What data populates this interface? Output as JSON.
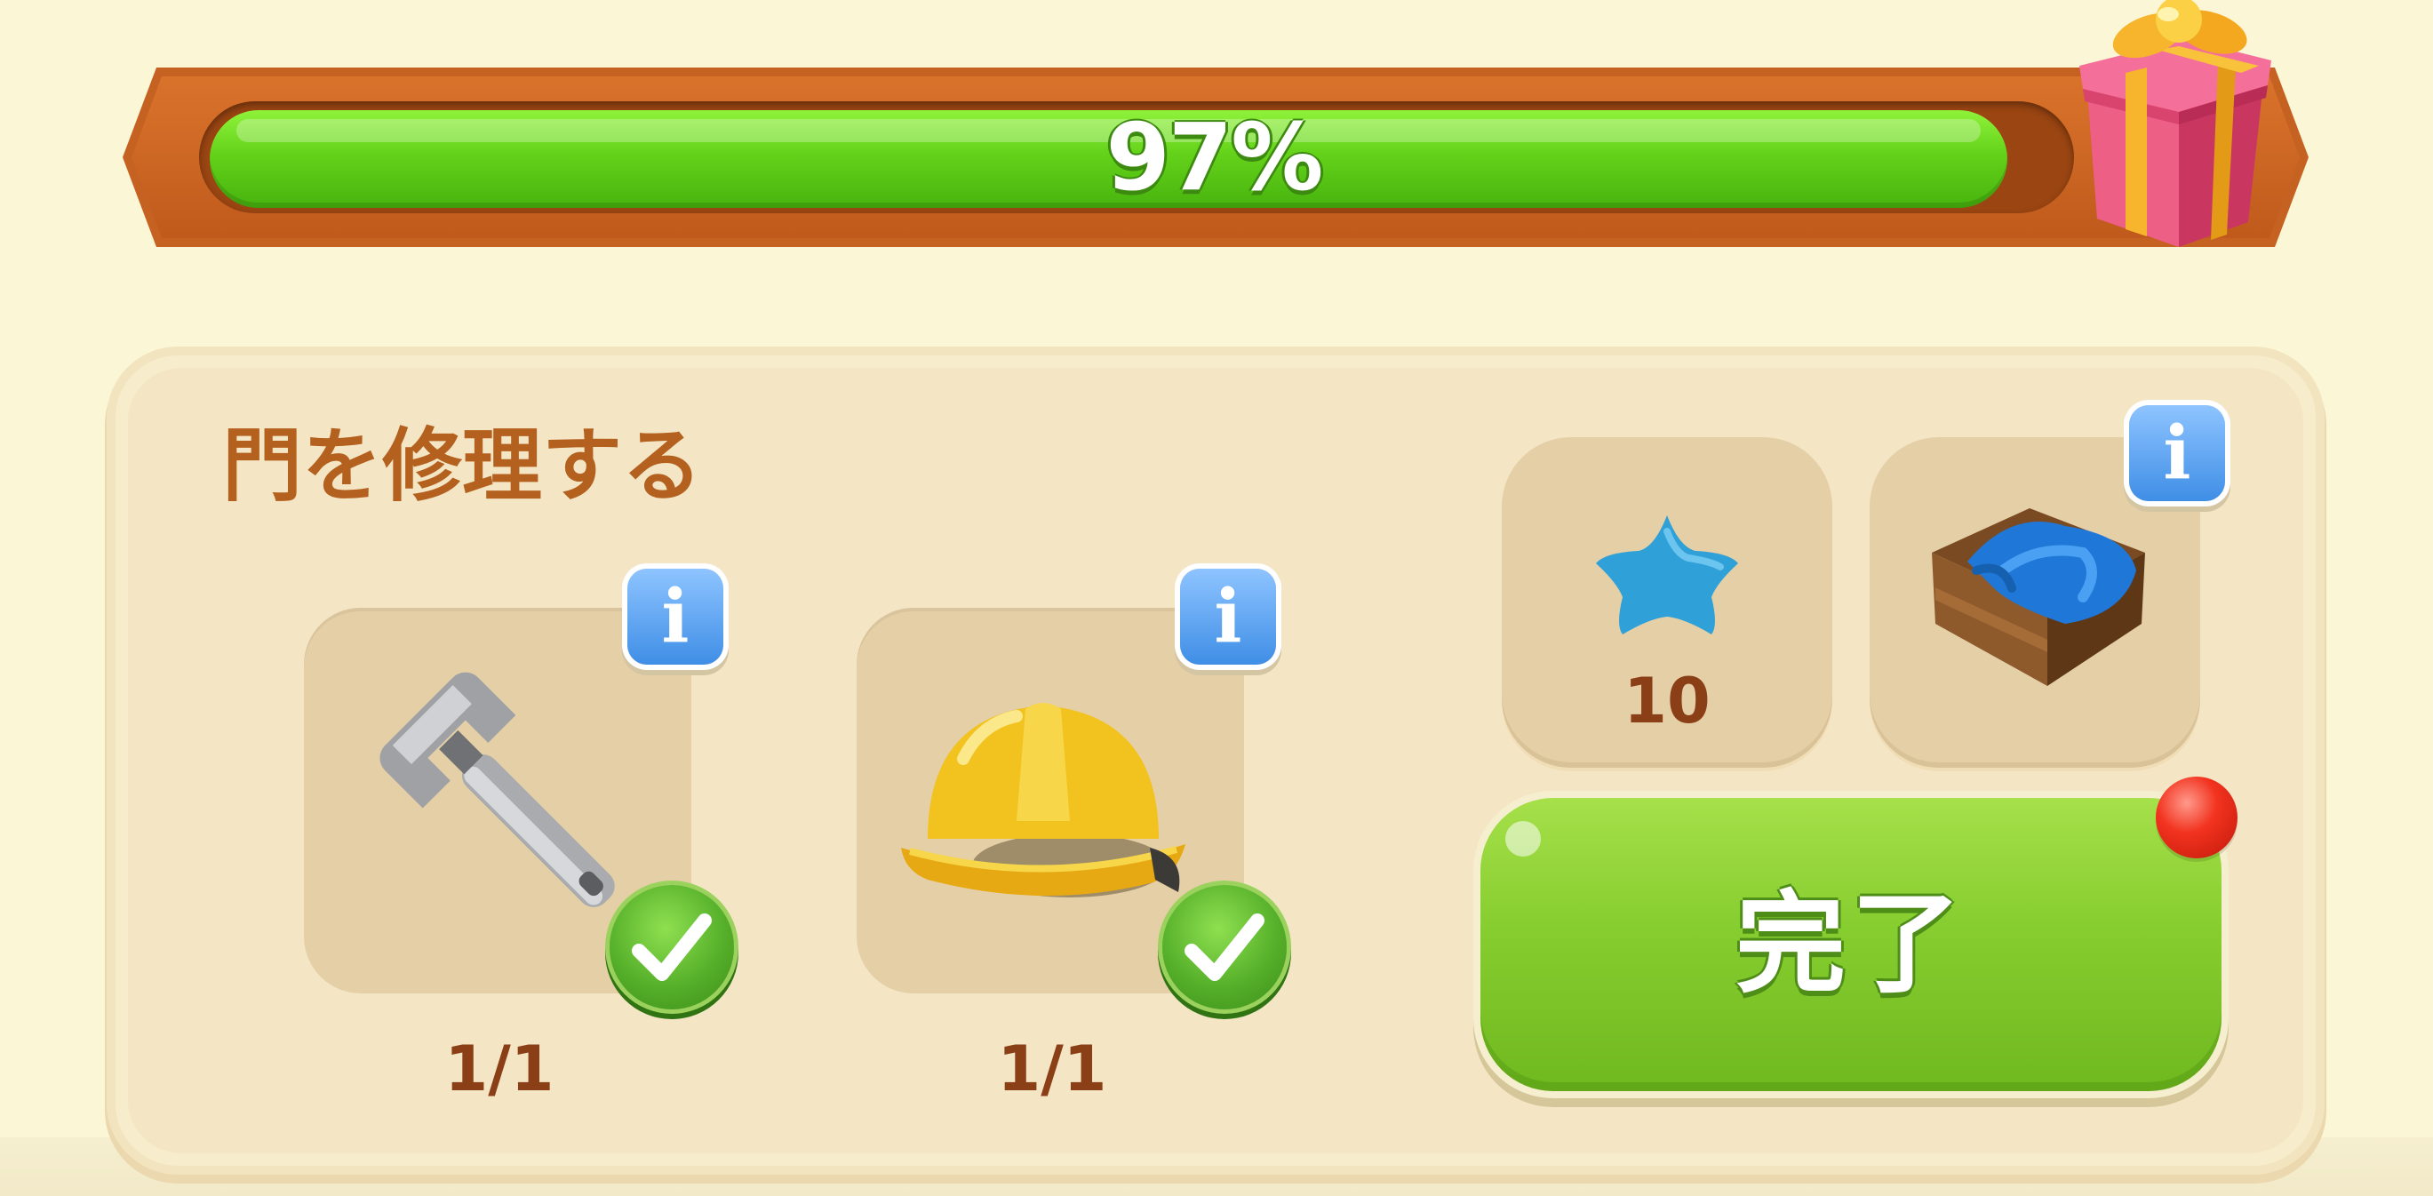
{
  "progress": {
    "percent_label": "97%",
    "fraction": 0.97,
    "reward_icon": "gift-box-icon"
  },
  "quest": {
    "title": "門を修理する",
    "requirements": [
      {
        "icon": "wrench-icon",
        "count": "1/1",
        "completed": true
      },
      {
        "icon": "hard-hat-icon",
        "count": "1/1",
        "completed": true
      }
    ],
    "rewards": [
      {
        "icon": "blue-star-icon",
        "amount": "10"
      },
      {
        "icon": "blue-cloth-crate-icon"
      }
    ],
    "complete_button": "完了"
  },
  "colors": {
    "background": "#fbf6d6",
    "progress_frame": "#c56221",
    "progress_fill": "#64d21a",
    "title_text": "#b4611f",
    "count_text": "#8a3f16",
    "button_green": "#86cd2f",
    "info_blue": "#3f8ee6",
    "notification_red": "#f2331f"
  }
}
